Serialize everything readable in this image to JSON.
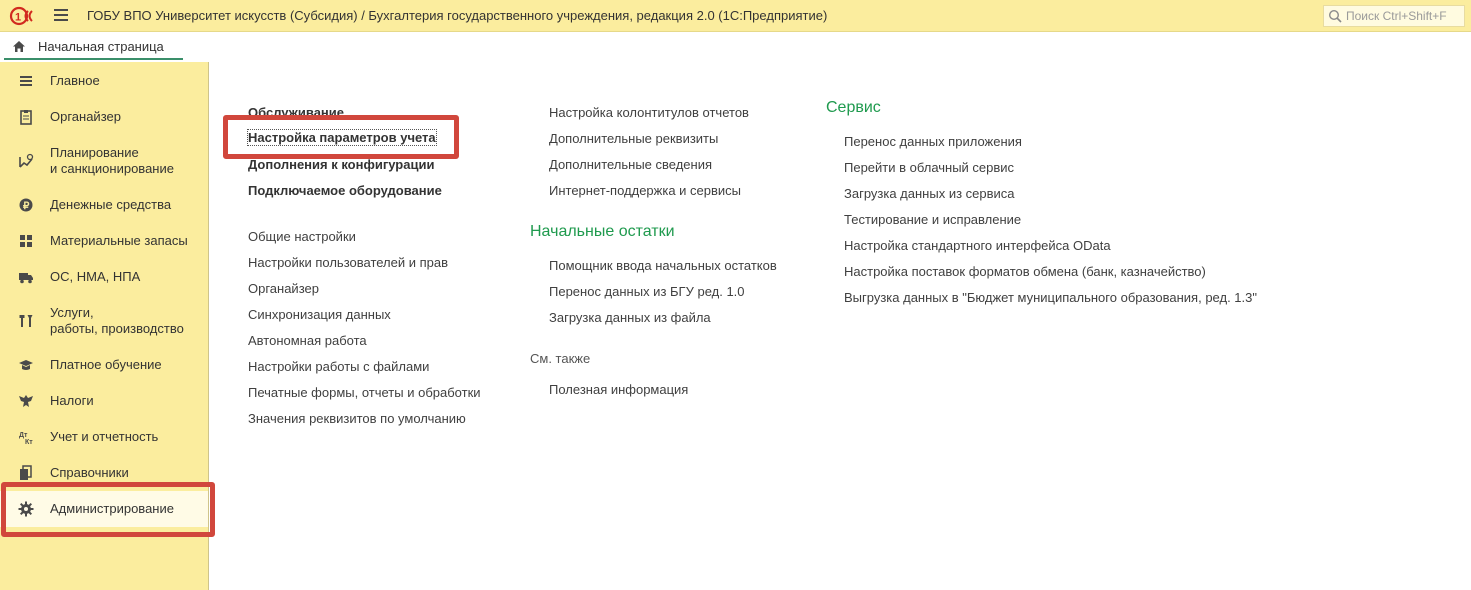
{
  "titlebar": {
    "logo_text": "1С",
    "title": "ГОБУ ВПО Университет искусств (Субсидия) / Бухгалтерия государственного учреждения, редакция 2.0  (1С:Предприятие)",
    "search_placeholder": "Поиск Ctrl+Shift+F"
  },
  "home_tab": {
    "label": "Начальная страница"
  },
  "sidebar": {
    "items": [
      {
        "label": "Главное",
        "icon": "menu-lines-icon"
      },
      {
        "label": "Органайзер",
        "icon": "clipboard-icon"
      },
      {
        "label": "Планирование\nи санкционирование",
        "icon": "planning-icon"
      },
      {
        "label": "Денежные средства",
        "icon": "coin-icon"
      },
      {
        "label": "Материальные запасы",
        "icon": "grid-icon"
      },
      {
        "label": "ОС, НМА, НПА",
        "icon": "truck-icon"
      },
      {
        "label": "Услуги,\nработы, производство",
        "icon": "tools-icon"
      },
      {
        "label": "Платное обучение",
        "icon": "graduation-cap-icon"
      },
      {
        "label": "Налоги",
        "icon": "eagle-icon"
      },
      {
        "label": "Учет и отчетность",
        "icon": "debit-credit-icon"
      },
      {
        "label": "Справочники",
        "icon": "books-icon"
      },
      {
        "label": "Администрирование",
        "icon": "gear-icon"
      }
    ]
  },
  "col1": {
    "bold_links": [
      "Обслуживание",
      "Настройка параметров учета",
      "Дополнения к конфигурации",
      "Подключаемое оборудование"
    ],
    "links": [
      "Общие настройки",
      "Настройки пользователей и прав",
      "Органайзер",
      "Синхронизация данных",
      "Автономная работа",
      "Настройки работы с файлами",
      "Печатные формы, отчеты и обработки",
      "Значения реквизитов по умолчанию"
    ]
  },
  "col2": {
    "links": [
      "Настройка колонтитулов отчетов",
      "Дополнительные реквизиты",
      "Дополнительные сведения",
      "Интернет-поддержка и сервисы"
    ],
    "section_title": "Начальные остатки",
    "section_links": [
      "Помощник ввода начальных остатков",
      "Перенос данных из БГУ ред. 1.0",
      "Загрузка данных из файла"
    ],
    "see_also_title": "См. также",
    "see_also_links": [
      "Полезная информация"
    ]
  },
  "col3": {
    "section_title": "Сервис",
    "links": [
      "Перенос данных приложения",
      "Перейти в облачный сервис",
      "Загрузка данных из сервиса",
      "Тестирование и исправление",
      "Настройка стандартного интерфейса OData",
      "Настройка поставок форматов обмена (банк, казначейство)",
      "Выгрузка данных в \"Бюджет муниципального образования, ред. 1.3\""
    ]
  },
  "colors": {
    "section_heading": "#1f9a4e",
    "highlight": "#d1473c",
    "panel": "#fbed9e"
  }
}
